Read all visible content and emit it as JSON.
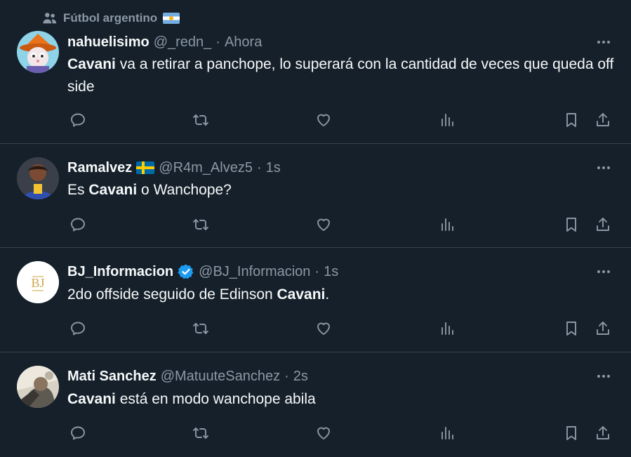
{
  "community": {
    "name": "Fútbol argentino",
    "icon": "community-icon"
  },
  "tweets": [
    {
      "name": "nahuelisimo",
      "handle": "@_redn_",
      "dot": "·",
      "time": "Ahora",
      "text_bold": "Cavani",
      "text_rest": " va a retirar a panchope, lo superará con la cantidad de veces que queda off side",
      "avatar_desc": "cartoon-avatar"
    },
    {
      "name": "Ramalvez",
      "handle": "@R4m_Alvez5",
      "dot": "·",
      "time": "1s",
      "text_pre": "Es ",
      "text_bold": "Cavani",
      "text_rest": " o Wanchope?",
      "avatar_desc": "player-photo"
    },
    {
      "name": "BJ_Informacion",
      "handle": "@BJ_Informacion",
      "dot": "·",
      "time": "1s",
      "text_pre": "2do offside seguido de Edinson ",
      "text_bold": "Cavani",
      "text_rest": ".",
      "avatar_text": "BJ"
    },
    {
      "name": "Mati Sanchez",
      "handle": "@MatuuteSanchez",
      "dot": "·",
      "time": "2s",
      "text_bold": "Cavani",
      "text_rest": " está en modo wanchope abila",
      "avatar_desc": "photo-avatar"
    }
  ],
  "icons": {
    "reply": "reply-icon",
    "retweet": "retweet-icon",
    "like": "like-icon",
    "views": "views-icon",
    "bookmark": "bookmark-icon",
    "share": "share-icon",
    "more": "more-icon",
    "verified": "verified-badge-icon"
  },
  "colors": {
    "background": "#15202b",
    "divider": "#38444d",
    "text": "#f7f9f9",
    "secondary": "#8b98a5",
    "verified": "#1d9bf0"
  }
}
